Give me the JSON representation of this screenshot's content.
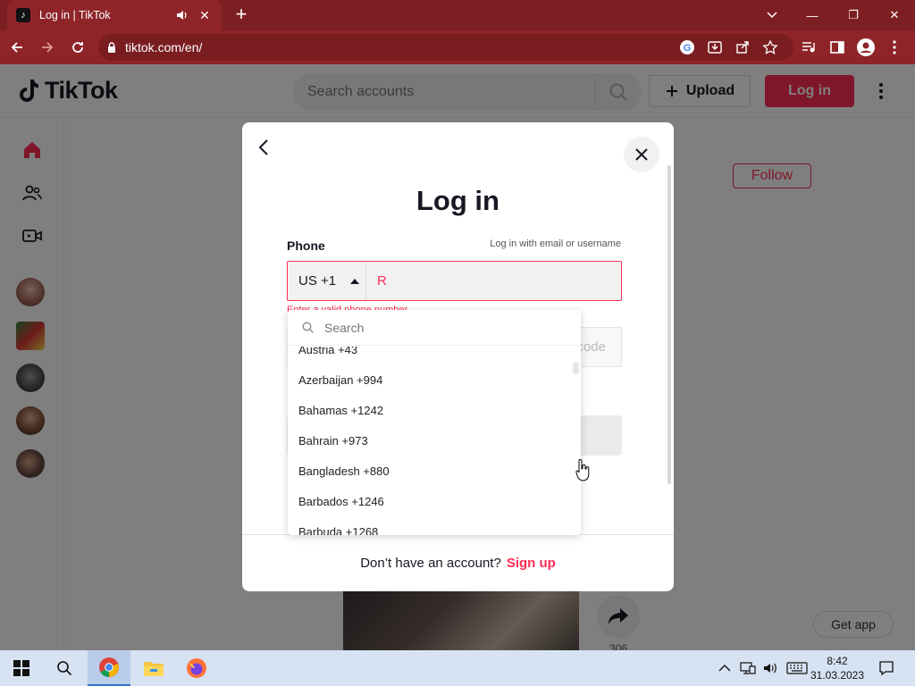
{
  "browser": {
    "tab_title": "Log in | TikTok",
    "url": "tiktok.com/en/"
  },
  "header": {
    "logo_text": "TikTok",
    "search_placeholder": "Search accounts",
    "upload_label": "Upload",
    "login_label": "Log in"
  },
  "background": {
    "follow_label": "Follow",
    "share_count": "306",
    "get_app_label": "Get app"
  },
  "modal": {
    "title": "Log in",
    "phone_label": "Phone",
    "alt_login_link": "Log in with email or username",
    "country_code": "US +1",
    "phone_value": "R",
    "error_text": "Enter a valid phone number",
    "send_code_label": "Send code",
    "footer_text": "Don’t have an account?",
    "signup_label": "Sign up"
  },
  "country_dropdown": {
    "search_placeholder": "Search",
    "items": [
      "Austria +43",
      "Azerbaijan +994",
      "Bahamas +1242",
      "Bahrain +973",
      "Bangladesh +880",
      "Barbados +1246",
      "Barbuda +1268"
    ]
  },
  "taskbar": {
    "time": "8:42",
    "date": "31.03.2023"
  },
  "colors": {
    "brand": "#fe2c55",
    "browser_frame": "#8e2428",
    "overlay": "rgba(0,0,0,0.5)"
  }
}
